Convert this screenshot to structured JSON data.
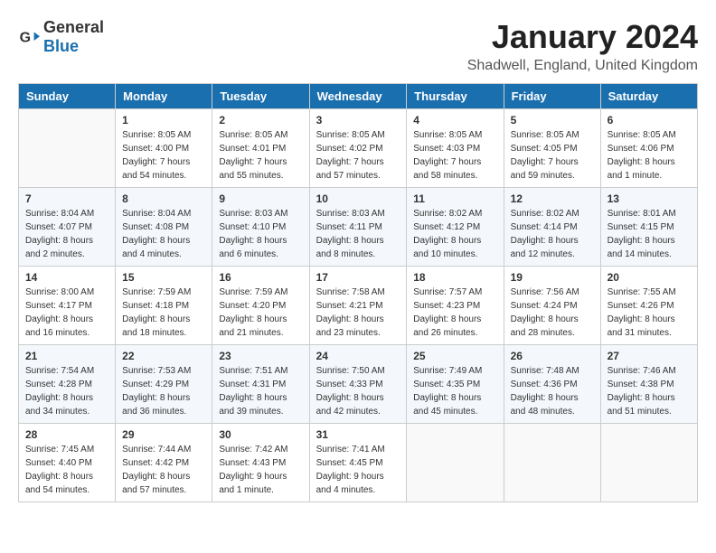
{
  "header": {
    "logo_general": "General",
    "logo_blue": "Blue",
    "title": "January 2024",
    "subtitle": "Shadwell, England, United Kingdom"
  },
  "days_of_week": [
    "Sunday",
    "Monday",
    "Tuesday",
    "Wednesday",
    "Thursday",
    "Friday",
    "Saturday"
  ],
  "weeks": [
    [
      {
        "day": "",
        "info": ""
      },
      {
        "day": "1",
        "info": "Sunrise: 8:05 AM\nSunset: 4:00 PM\nDaylight: 7 hours\nand 54 minutes."
      },
      {
        "day": "2",
        "info": "Sunrise: 8:05 AM\nSunset: 4:01 PM\nDaylight: 7 hours\nand 55 minutes."
      },
      {
        "day": "3",
        "info": "Sunrise: 8:05 AM\nSunset: 4:02 PM\nDaylight: 7 hours\nand 57 minutes."
      },
      {
        "day": "4",
        "info": "Sunrise: 8:05 AM\nSunset: 4:03 PM\nDaylight: 7 hours\nand 58 minutes."
      },
      {
        "day": "5",
        "info": "Sunrise: 8:05 AM\nSunset: 4:05 PM\nDaylight: 7 hours\nand 59 minutes."
      },
      {
        "day": "6",
        "info": "Sunrise: 8:05 AM\nSunset: 4:06 PM\nDaylight: 8 hours\nand 1 minute."
      }
    ],
    [
      {
        "day": "7",
        "info": "Sunrise: 8:04 AM\nSunset: 4:07 PM\nDaylight: 8 hours\nand 2 minutes."
      },
      {
        "day": "8",
        "info": "Sunrise: 8:04 AM\nSunset: 4:08 PM\nDaylight: 8 hours\nand 4 minutes."
      },
      {
        "day": "9",
        "info": "Sunrise: 8:03 AM\nSunset: 4:10 PM\nDaylight: 8 hours\nand 6 minutes."
      },
      {
        "day": "10",
        "info": "Sunrise: 8:03 AM\nSunset: 4:11 PM\nDaylight: 8 hours\nand 8 minutes."
      },
      {
        "day": "11",
        "info": "Sunrise: 8:02 AM\nSunset: 4:12 PM\nDaylight: 8 hours\nand 10 minutes."
      },
      {
        "day": "12",
        "info": "Sunrise: 8:02 AM\nSunset: 4:14 PM\nDaylight: 8 hours\nand 12 minutes."
      },
      {
        "day": "13",
        "info": "Sunrise: 8:01 AM\nSunset: 4:15 PM\nDaylight: 8 hours\nand 14 minutes."
      }
    ],
    [
      {
        "day": "14",
        "info": "Sunrise: 8:00 AM\nSunset: 4:17 PM\nDaylight: 8 hours\nand 16 minutes."
      },
      {
        "day": "15",
        "info": "Sunrise: 7:59 AM\nSunset: 4:18 PM\nDaylight: 8 hours\nand 18 minutes."
      },
      {
        "day": "16",
        "info": "Sunrise: 7:59 AM\nSunset: 4:20 PM\nDaylight: 8 hours\nand 21 minutes."
      },
      {
        "day": "17",
        "info": "Sunrise: 7:58 AM\nSunset: 4:21 PM\nDaylight: 8 hours\nand 23 minutes."
      },
      {
        "day": "18",
        "info": "Sunrise: 7:57 AM\nSunset: 4:23 PM\nDaylight: 8 hours\nand 26 minutes."
      },
      {
        "day": "19",
        "info": "Sunrise: 7:56 AM\nSunset: 4:24 PM\nDaylight: 8 hours\nand 28 minutes."
      },
      {
        "day": "20",
        "info": "Sunrise: 7:55 AM\nSunset: 4:26 PM\nDaylight: 8 hours\nand 31 minutes."
      }
    ],
    [
      {
        "day": "21",
        "info": "Sunrise: 7:54 AM\nSunset: 4:28 PM\nDaylight: 8 hours\nand 34 minutes."
      },
      {
        "day": "22",
        "info": "Sunrise: 7:53 AM\nSunset: 4:29 PM\nDaylight: 8 hours\nand 36 minutes."
      },
      {
        "day": "23",
        "info": "Sunrise: 7:51 AM\nSunset: 4:31 PM\nDaylight: 8 hours\nand 39 minutes."
      },
      {
        "day": "24",
        "info": "Sunrise: 7:50 AM\nSunset: 4:33 PM\nDaylight: 8 hours\nand 42 minutes."
      },
      {
        "day": "25",
        "info": "Sunrise: 7:49 AM\nSunset: 4:35 PM\nDaylight: 8 hours\nand 45 minutes."
      },
      {
        "day": "26",
        "info": "Sunrise: 7:48 AM\nSunset: 4:36 PM\nDaylight: 8 hours\nand 48 minutes."
      },
      {
        "day": "27",
        "info": "Sunrise: 7:46 AM\nSunset: 4:38 PM\nDaylight: 8 hours\nand 51 minutes."
      }
    ],
    [
      {
        "day": "28",
        "info": "Sunrise: 7:45 AM\nSunset: 4:40 PM\nDaylight: 8 hours\nand 54 minutes."
      },
      {
        "day": "29",
        "info": "Sunrise: 7:44 AM\nSunset: 4:42 PM\nDaylight: 8 hours\nand 57 minutes."
      },
      {
        "day": "30",
        "info": "Sunrise: 7:42 AM\nSunset: 4:43 PM\nDaylight: 9 hours\nand 1 minute."
      },
      {
        "day": "31",
        "info": "Sunrise: 7:41 AM\nSunset: 4:45 PM\nDaylight: 9 hours\nand 4 minutes."
      },
      {
        "day": "",
        "info": ""
      },
      {
        "day": "",
        "info": ""
      },
      {
        "day": "",
        "info": ""
      }
    ]
  ]
}
